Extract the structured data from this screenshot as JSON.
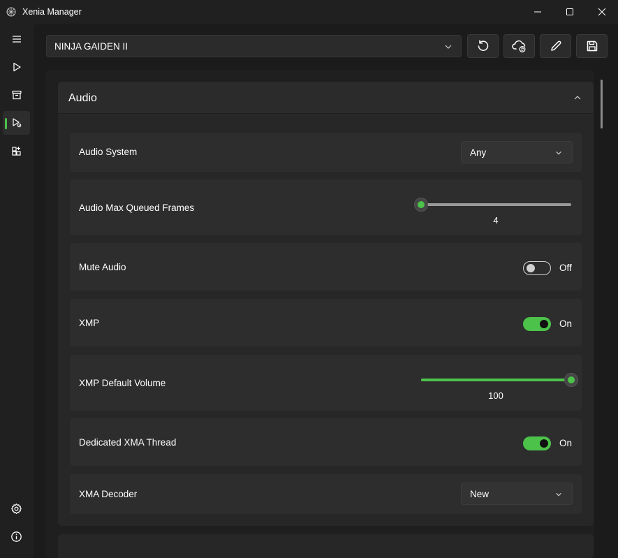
{
  "window": {
    "title": "Xenia Manager",
    "controls": {
      "minimize": "minimize-icon",
      "maximize": "maximize-icon",
      "close": "close-icon"
    }
  },
  "nav": {
    "items": [
      {
        "name": "menu",
        "icon": "hamburger-icon"
      },
      {
        "name": "play",
        "icon": "play-icon"
      },
      {
        "name": "library",
        "icon": "archive-icon"
      },
      {
        "name": "manage",
        "icon": "game-settings-icon",
        "active": true
      },
      {
        "name": "addons",
        "icon": "grid-add-icon"
      }
    ],
    "bottom": [
      {
        "name": "settings",
        "icon": "gear-icon"
      },
      {
        "name": "about",
        "icon": "info-icon"
      }
    ]
  },
  "toolbar": {
    "game_selected": "NINJA GAIDEN II",
    "buttons": [
      "reset-icon",
      "cloud-sync-icon",
      "edit-icon",
      "save-icon"
    ]
  },
  "section": {
    "title": "Audio",
    "rows": {
      "audio_system": {
        "label": "Audio System",
        "value": "Any"
      },
      "max_queued_frames": {
        "label": "Audio Max Queued Frames",
        "value": "4",
        "min": 4,
        "max": 64,
        "fraction": 0.0
      },
      "mute_audio": {
        "label": "Mute Audio",
        "state": "Off"
      },
      "xmp": {
        "label": "XMP",
        "state": "On"
      },
      "xmp_volume": {
        "label": "XMP Default Volume",
        "value": "100",
        "min": 0,
        "max": 100,
        "fraction": 1.0
      },
      "dedicated_xma": {
        "label": "Dedicated XMA Thread",
        "state": "On"
      },
      "xma_decoder": {
        "label": "XMA Decoder",
        "value": "New"
      }
    }
  },
  "colors": {
    "accent": "#4cc24a",
    "background": "#202020",
    "card": "#2d2d2d"
  }
}
